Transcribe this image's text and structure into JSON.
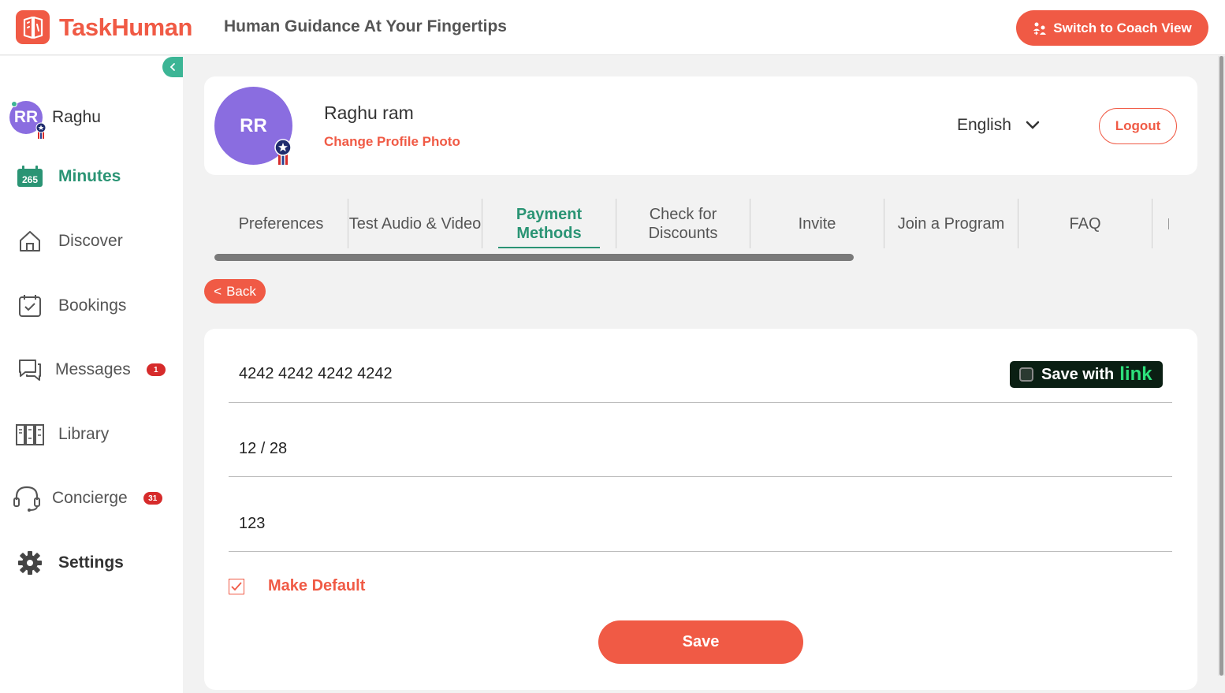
{
  "header": {
    "brand": "TaskHuman",
    "tagline": "Human Guidance At Your Fingertips",
    "coach_button": "Switch to Coach View"
  },
  "sidebar": {
    "user": {
      "initials": "RR",
      "name": "Raghu"
    },
    "minutes": {
      "count": "265",
      "label": "Minutes"
    },
    "items": [
      {
        "label": "Discover",
        "icon": "home-icon"
      },
      {
        "label": "Bookings",
        "icon": "calendar-check-icon"
      },
      {
        "label": "Messages",
        "icon": "chat-icon",
        "badge": "1"
      },
      {
        "label": "Library",
        "icon": "library-icon"
      },
      {
        "label": "Concierge",
        "icon": "headset-icon",
        "badge": "31"
      },
      {
        "label": "Settings",
        "icon": "gear-icon"
      }
    ]
  },
  "profile": {
    "initials": "RR",
    "name": "Raghu ram",
    "change_photo": "Change Profile Photo",
    "language": "English",
    "logout": "Logout"
  },
  "tabs": [
    {
      "label": "Preferences"
    },
    {
      "label": "Test Audio & Video"
    },
    {
      "label": "Payment Methods",
      "active": true
    },
    {
      "label": "Check for Discounts"
    },
    {
      "label": "Invite"
    },
    {
      "label": "Join a Program"
    },
    {
      "label": "FAQ"
    }
  ],
  "back_button": "Back",
  "payment": {
    "card_number": "4242 4242 4242 4242",
    "expiry": "12 / 28",
    "cvc": "123",
    "save_with_prefix": "Save with",
    "save_with_brand": "link",
    "make_default": "Make Default",
    "make_default_checked": true,
    "save_button": "Save"
  },
  "colors": {
    "brand": "#f05a45",
    "accent_green": "#2a9474",
    "avatar_purple": "#8a6de0",
    "badge_red": "#d62b2b"
  }
}
